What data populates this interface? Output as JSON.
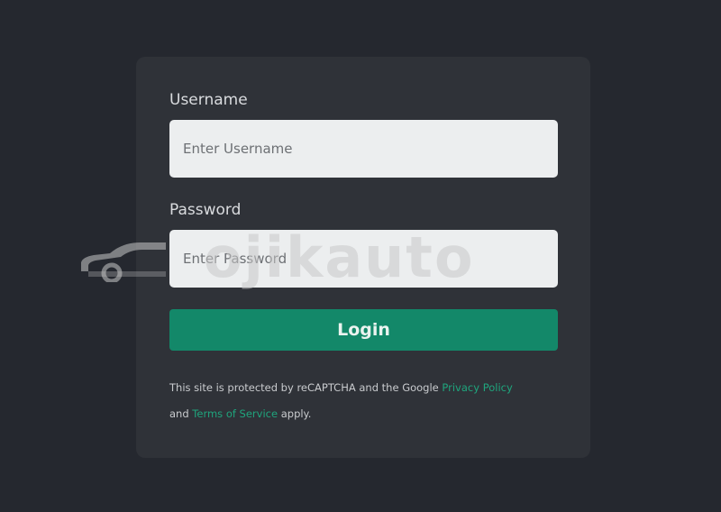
{
  "form": {
    "username_label": "Username",
    "username_placeholder": "Enter Username",
    "password_label": "Password",
    "password_placeholder": "Enter Password",
    "login_label": "Login"
  },
  "legal": {
    "prefix": "This site is protected by reCAPTCHA and the Google ",
    "privacy_link": "Privacy Policy",
    "middle": "and ",
    "terms_link": "Terms of Service",
    "suffix": " apply."
  },
  "watermark": {
    "text": "ojikauto",
    "icon": "car-icon"
  },
  "colors": {
    "background": "#25282f",
    "card": "#2f3238",
    "accent": "#138869",
    "link": "#1fa57d"
  }
}
